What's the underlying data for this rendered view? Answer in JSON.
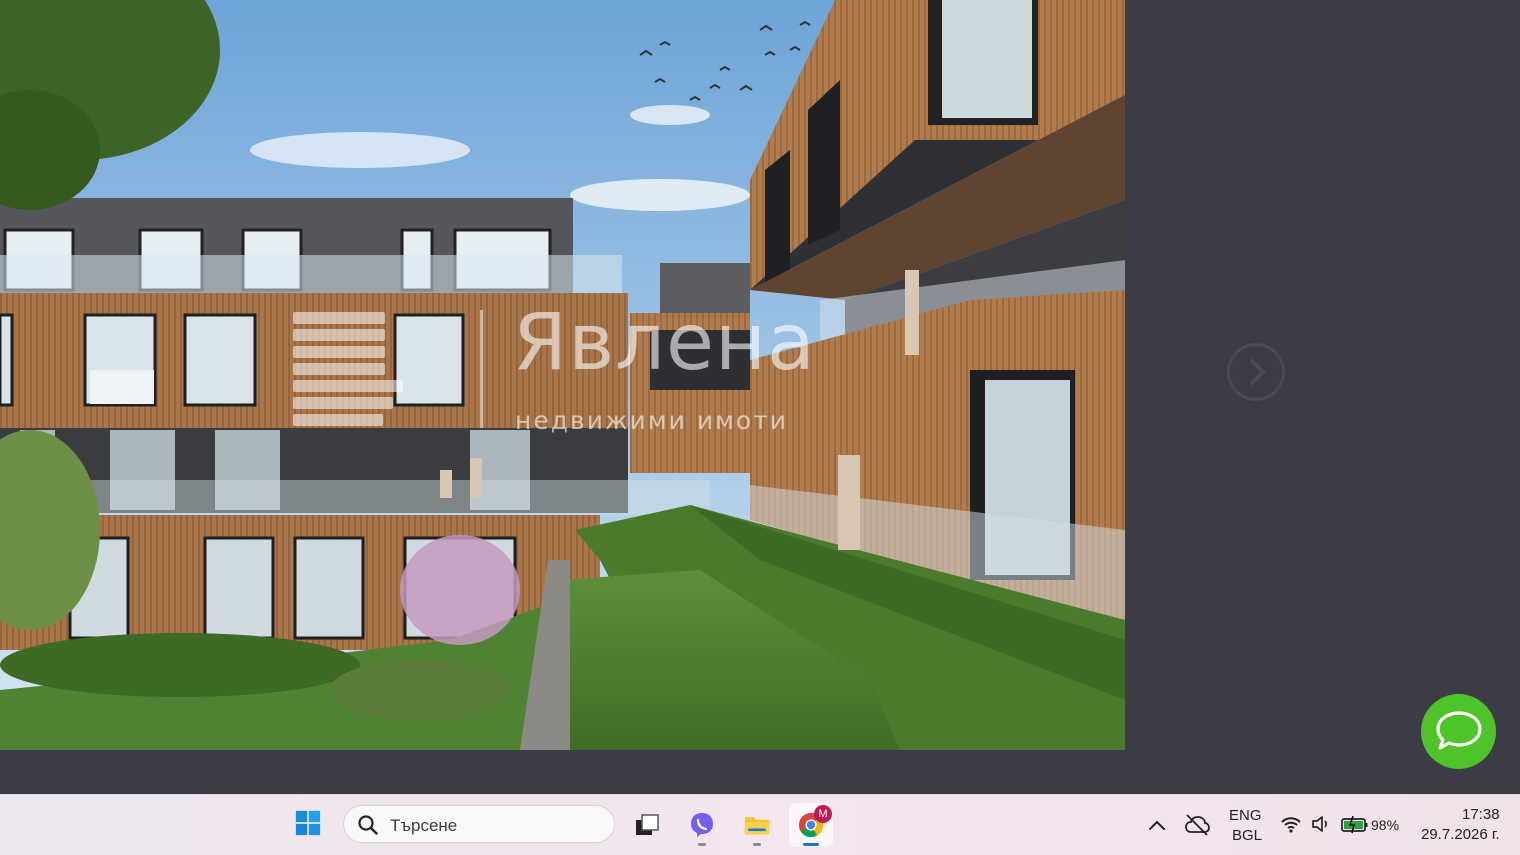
{
  "watermark": {
    "brand": "Явлена",
    "tagline": "недвижими имоти"
  },
  "viewer": {
    "next_icon": "chevron-right-icon",
    "chat_icon": "chat-bubble-icon",
    "chat_color": "#4ec42a",
    "background": "#3b3c46"
  },
  "taskbar": {
    "start_icon": "windows-start-icon",
    "search_placeholder": "Търсене",
    "apps": [
      {
        "name": "task-view",
        "icon": "task-view-icon"
      },
      {
        "name": "viber",
        "icon": "viber-icon",
        "color": "#7360f2"
      },
      {
        "name": "file-explorer",
        "icon": "folder-icon",
        "color": "#f4c430"
      },
      {
        "name": "chrome",
        "icon": "chrome-icon",
        "badge": "M",
        "active": true
      }
    ],
    "tray": {
      "lang_top": "ENG",
      "lang_bottom": "BGL",
      "battery": "98%",
      "time": "17:38",
      "date": "29.7.2026 г."
    }
  }
}
